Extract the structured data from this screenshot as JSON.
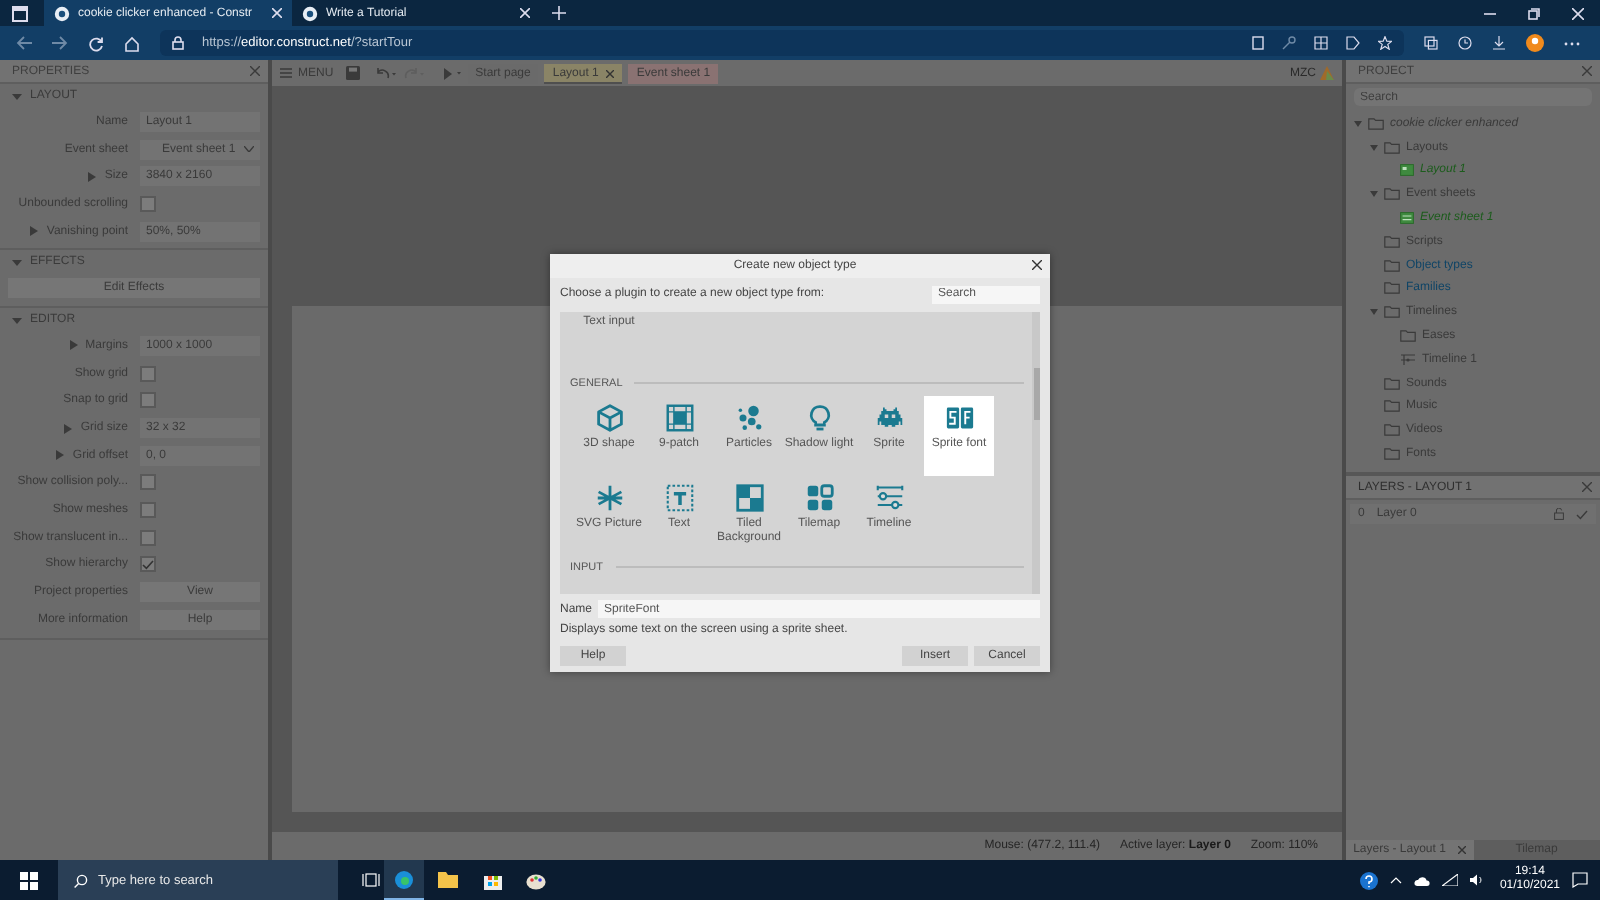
{
  "browser": {
    "tabs": [
      {
        "title": "cookie clicker enhanced - Constr",
        "selected": true
      },
      {
        "title": "Write a Tutorial",
        "selected": false
      }
    ],
    "url": "https://**editor.construct.net**/?startTour"
  },
  "properties": {
    "title": "PROPERTIES",
    "sections": [
      {
        "title": "LAYOUT",
        "expanded": true,
        "rows": [
          {
            "kind": "text",
            "label": "Name",
            "value": "Layout 1"
          },
          {
            "kind": "dropdown",
            "label": "Event sheet",
            "value": "Event sheet 1"
          },
          {
            "kind": "group",
            "label": "Size",
            "value": "3840 x 2160",
            "expanded": false
          },
          {
            "kind": "checkbox",
            "label": "Unbounded scrolling",
            "checked": false
          },
          {
            "kind": "group",
            "label": "Vanishing point",
            "value": "50%, 50%",
            "expanded": false
          }
        ]
      },
      {
        "title": "EFFECTS",
        "expanded": true,
        "rows": [
          {
            "kind": "wide-button",
            "value": "Edit Effects"
          }
        ]
      },
      {
        "title": "EDITOR",
        "expanded": true,
        "rows": [
          {
            "kind": "group",
            "label": "Margins",
            "value": "1000 x 1000",
            "expanded": false
          },
          {
            "kind": "checkbox",
            "label": "Show grid",
            "checked": false
          },
          {
            "kind": "checkbox",
            "label": "Snap to grid",
            "checked": false
          },
          {
            "kind": "group",
            "label": "Grid size",
            "value": "32 x 32",
            "expanded": false
          },
          {
            "kind": "group",
            "label": "Grid offset",
            "value": "0, 0",
            "expanded": false
          },
          {
            "kind": "checkbox",
            "label": "Show collision poly...",
            "checked": false
          },
          {
            "kind": "checkbox",
            "label": "Show meshes",
            "checked": false
          },
          {
            "kind": "checkbox",
            "label": "Show translucent in...",
            "checked": false
          },
          {
            "kind": "checkbox",
            "label": "Show hierarchy",
            "checked": true
          },
          {
            "kind": "button",
            "label": "Project properties",
            "value": "View"
          },
          {
            "kind": "button",
            "label": "More information",
            "value": "Help"
          }
        ]
      }
    ]
  },
  "toolbar": {
    "menu": "MENU",
    "logo": "MZC",
    "tabs": [
      {
        "label": "Start page",
        "kind": "start",
        "selected": false,
        "closable": false
      },
      {
        "label": "Layout 1",
        "kind": "layout",
        "selected": true,
        "closable": true
      },
      {
        "label": "Event sheet 1",
        "kind": "eventsheet",
        "selected": false,
        "closable": false
      }
    ]
  },
  "status": {
    "mouse": "Mouse: (477.2, 111.4)",
    "active_layer": "Active layer: **Layer 0**",
    "zoom": "Zoom: 110%"
  },
  "dialog": {
    "title": "Create new object type",
    "prompt": "Choose a plugin to create a new object type from:",
    "search_placeholder": "Search",
    "sections": [
      {
        "items": [
          {
            "label": "Text input",
            "kind": "textinput",
            "selected": false
          }
        ]
      },
      {
        "title": "GENERAL",
        "items": [
          {
            "label": "3D shape",
            "kind": "shape3d",
            "selected": false
          },
          {
            "label": "9-patch",
            "kind": "ninepatch",
            "selected": false
          },
          {
            "label": "Particles",
            "kind": "particles",
            "selected": false
          },
          {
            "label": "Shadow light",
            "kind": "light",
            "selected": false
          },
          {
            "label": "Sprite",
            "kind": "sprite",
            "selected": false
          },
          {
            "label": "Sprite font",
            "kind": "spritefont",
            "selected": true
          },
          {
            "label": "SVG Picture",
            "kind": "svg",
            "selected": false
          },
          {
            "label": "Text",
            "kind": "text",
            "selected": false
          },
          {
            "label": "Tiled Background",
            "kind": "tiled",
            "selected": false
          },
          {
            "label": "Tilemap",
            "kind": "tilemap",
            "selected": false
          },
          {
            "label": "Timeline",
            "kind": "timeline",
            "selected": false
          }
        ]
      },
      {
        "title": "INPUT"
      }
    ],
    "name_label": "Name",
    "name_value": "SpriteFont",
    "description": "Displays some text on the screen using a sprite sheet.",
    "buttons": {
      "help": "Help",
      "insert": "Insert",
      "cancel": "Cancel"
    }
  },
  "project": {
    "title": "PROJECT",
    "search_placeholder": "Search",
    "tree": [
      {
        "label": "cookie clicker enhanced",
        "kind": "project",
        "expanded": true,
        "children": [
          {
            "label": "Layouts",
            "kind": "folder",
            "expanded": true,
            "children": [
              {
                "label": "Layout 1",
                "kind": "layout",
                "color": "#1c5c1c"
              }
            ]
          },
          {
            "label": "Event sheets",
            "kind": "folder",
            "expanded": true,
            "children": [
              {
                "label": "Event sheet 1",
                "kind": "eventsheet",
                "color": "#1c5c1c"
              }
            ]
          },
          {
            "label": "Scripts",
            "kind": "folder"
          },
          {
            "label": "Object types",
            "kind": "folder",
            "color": "#0f4466"
          },
          {
            "label": "Families",
            "kind": "folder",
            "color": "#0f4466"
          },
          {
            "label": "Timelines",
            "kind": "folder",
            "expanded": true,
            "children": [
              {
                "label": "Eases",
                "kind": "folder"
              },
              {
                "label": "Timeline 1",
                "kind": "timeline"
              }
            ]
          },
          {
            "label": "Sounds",
            "kind": "folder"
          },
          {
            "label": "Music",
            "kind": "folder"
          },
          {
            "label": "Videos",
            "kind": "folder"
          },
          {
            "label": "Fonts",
            "kind": "folder"
          }
        ]
      }
    ]
  },
  "layers": {
    "title": "LAYERS - LAYOUT 1",
    "rows": [
      {
        "index": "0",
        "name": "Layer 0",
        "locked": false,
        "visible": true
      }
    ]
  },
  "bottom_tabs": [
    {
      "label": "Layers - Layout 1",
      "selected": true
    },
    {
      "label": "Tilemap",
      "selected": false
    }
  ],
  "taskbar": {
    "search_placeholder": "Type here to search",
    "time": "19:14",
    "date": "01/10/2021"
  }
}
